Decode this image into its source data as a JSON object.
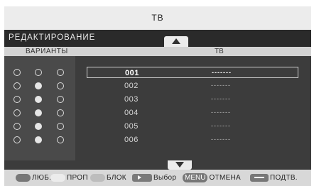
{
  "window": {
    "title": "ТВ"
  },
  "panel": {
    "title": "РЕДАКТИРОВАНИЕ"
  },
  "columns": {
    "options": "ВАРИАНТЫ",
    "channels": "ТВ"
  },
  "rows": [
    {
      "number": "001",
      "name": "-------",
      "options": [
        false,
        false,
        false
      ],
      "selected": true
    },
    {
      "number": "002",
      "name": "-------",
      "options": [
        false,
        true,
        false
      ],
      "selected": false
    },
    {
      "number": "003",
      "name": "-------",
      "options": [
        false,
        true,
        false
      ],
      "selected": false
    },
    {
      "number": "004",
      "name": "-------",
      "options": [
        false,
        true,
        false
      ],
      "selected": false
    },
    {
      "number": "005",
      "name": "-------",
      "options": [
        false,
        true,
        false
      ],
      "selected": false
    },
    {
      "number": "006",
      "name": "-------",
      "options": [
        false,
        true,
        false
      ],
      "selected": false
    }
  ],
  "footer": {
    "fav": "ЛЮБ.",
    "skip": "ПРОП",
    "lock": "БЛОК",
    "select": "Выбор",
    "menu_key": "MENU",
    "cancel": "ОТМЕНА",
    "confirm": "ПОДТВ."
  },
  "icons": {
    "scroll_up": "triangle-up-icon",
    "scroll_down": "triangle-down-icon",
    "fav_key": "red-key-icon",
    "skip_key": "green-key-icon",
    "lock_key": "yellow-key-icon",
    "select_key": "arrow-right-key-icon",
    "confirm_key": "enter-key-icon"
  }
}
